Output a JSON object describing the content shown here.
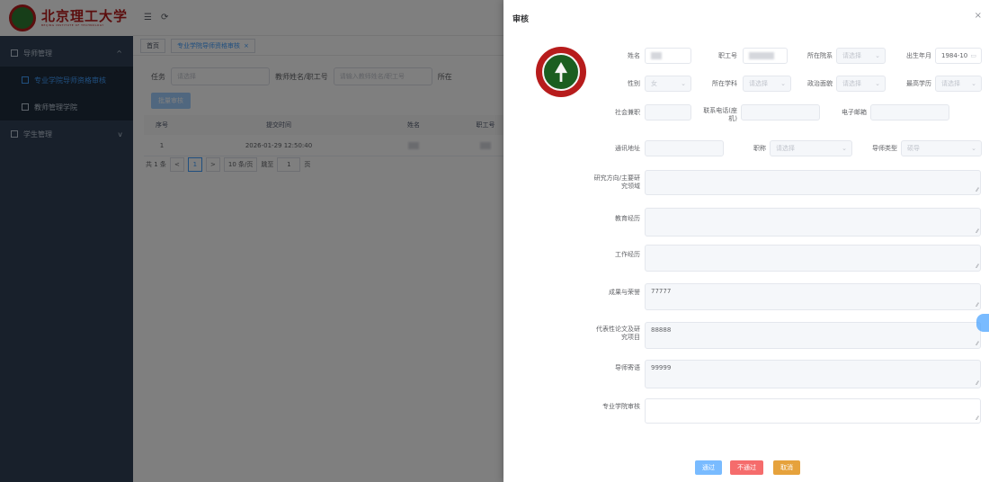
{
  "logo": {
    "cn": "北京理工大学",
    "en": "BEIJING INSTITUTE OF TECHNOLOGY"
  },
  "sidebar": {
    "items": [
      {
        "label": "导师管理",
        "arrow": "^"
      },
      {
        "label": "专业学院导师资格审核"
      },
      {
        "label": "教师管理学院"
      },
      {
        "label": "学生管理",
        "arrow": "v"
      }
    ]
  },
  "navbar": {
    "menu_icon": "☰",
    "refresh_icon": "⟳"
  },
  "tags": [
    {
      "label": "首页"
    },
    {
      "label": "专业学院导师资格审核",
      "close": "×"
    }
  ],
  "filters": {
    "task_label": "任务",
    "task_placeholder": "请选择",
    "teacher_label": "教师姓名/职工号",
    "teacher_placeholder": "请输入教师姓名/职工号",
    "dept_label": "所在"
  },
  "batch_button": "批量审核",
  "table": {
    "headers": [
      "序号",
      "提交时间",
      "姓名",
      "职工号"
    ],
    "rows": [
      {
        "index": "1",
        "time": "2026-01-29 12:50:40"
      }
    ]
  },
  "pager": {
    "total": "共 1 条",
    "prev": "<",
    "page": "1",
    "next": ">",
    "size": "10 条/页",
    "goto": "跳至",
    "goto_value": "1",
    "page_unit": "页"
  },
  "drawer": {
    "title": "审核",
    "close": "×",
    "fields": {
      "name_label": "姓名",
      "staff_id_label": "职工号",
      "college_label": "所在院系",
      "college_placeholder": "请选择",
      "birth_label": "出生年月",
      "birth_value": "1984-10",
      "gender_label": "性别",
      "gender_value": "女",
      "subject_label": "所在学科",
      "subject_placeholder": "请选择",
      "political_label": "政治面貌",
      "political_placeholder": "请选择",
      "degree_label": "最高学历",
      "degree_placeholder": "请选择",
      "social_label": "社会兼职",
      "phone_label": "联系电话(座机)",
      "email_label": "电子邮箱",
      "address_label": "通讯地址",
      "title_label": "职称",
      "title_placeholder": "请选择",
      "tutor_type_label": "导师类型",
      "tutor_type_placeholder": "硕导",
      "research_label": "研究方向/主要研究领域",
      "education_label": "教育经历",
      "work_label": "工作经历",
      "achievement_label": "成果与荣誉",
      "achievement_value": "77777",
      "papers_label": "代表性论文及研究项目",
      "papers_value": "88888",
      "message_label": "导师寄语",
      "message_value": "99999",
      "review_label": "专业学院审核"
    },
    "buttons": {
      "pass": "通过",
      "fail": "不通过",
      "cancel": "取消"
    }
  }
}
